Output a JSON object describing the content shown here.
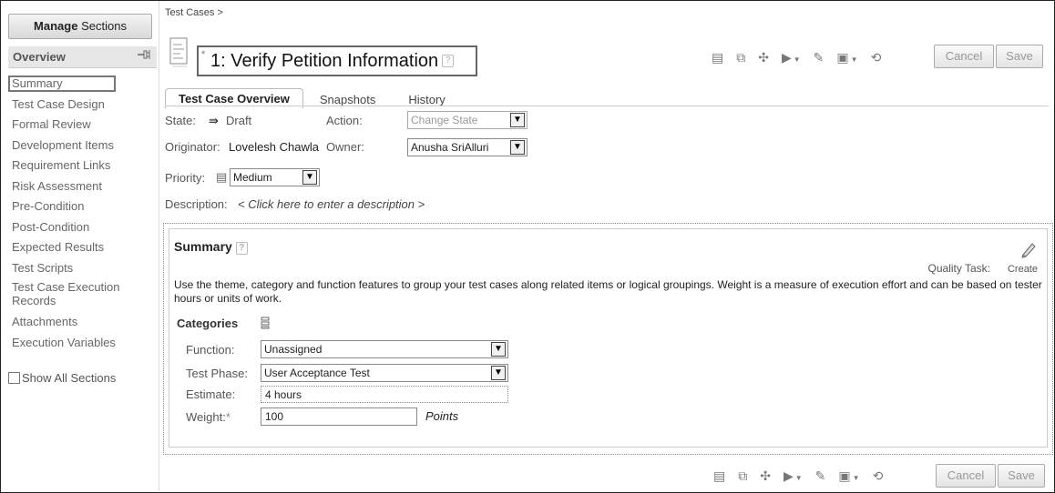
{
  "sidebar": {
    "manage_bold": "Manage",
    "manage_rest": "Sections",
    "overview_label": "Overview",
    "pin_icon": "pin-icon",
    "items": [
      {
        "label": "Summary",
        "active": true
      },
      {
        "label": "Test Case Design"
      },
      {
        "label": "Formal Review"
      },
      {
        "label": "Development Items"
      },
      {
        "label": "Requirement Links"
      },
      {
        "label": "Risk Assessment"
      },
      {
        "label": "Pre-Condition"
      },
      {
        "label": "Post-Condition"
      },
      {
        "label": "Expected Results"
      },
      {
        "label": "Test Scripts"
      },
      {
        "label": "Test Case Execution Records"
      },
      {
        "label": "Attachments"
      },
      {
        "label": "Execution Variables"
      }
    ],
    "show_all_label": "Show All Sections"
  },
  "breadcrumb": "Test Cases >",
  "header": {
    "title_star": "*",
    "title": "1: Verify Petition Information",
    "help": "?",
    "cancel_label": "Cancel",
    "save_label": "Save"
  },
  "tabs": [
    "Test Case Overview",
    "Snapshots",
    "History"
  ],
  "overview": {
    "state_label": "State:",
    "state_value": "Draft",
    "action_label": "Action:",
    "action_value": "Change State",
    "originator_label": "Originator:",
    "originator_value": "Lovelesh Chawla",
    "owner_label": "Owner:",
    "owner_value": "Anusha SriAlluri",
    "priority_label": "Priority:",
    "priority_value": "Medium",
    "description_label": "Description:",
    "description_value": "< Click here to enter a description >"
  },
  "summary": {
    "title": "Summary",
    "help": "?",
    "quality_task_label": "Quality Task:",
    "quality_task_action": "Create",
    "description": "Use the theme, category and function features to group your test cases along related items or logical groupings. Weight is a measure of execution effort and can be based on tester hours or units of work.",
    "categories_label": "Categories",
    "function_label": "Function:",
    "function_value": "Unassigned",
    "phase_label": "Test Phase:",
    "phase_value": "User Acceptance Test",
    "estimate_label": "Estimate:",
    "estimate_value": "4 hours",
    "weight_label": "Weight:",
    "weight_star": "*",
    "weight_value": "100",
    "points_label": "Points"
  },
  "colors": {
    "accent_border": "#666666",
    "disabled_text": "#999999"
  }
}
